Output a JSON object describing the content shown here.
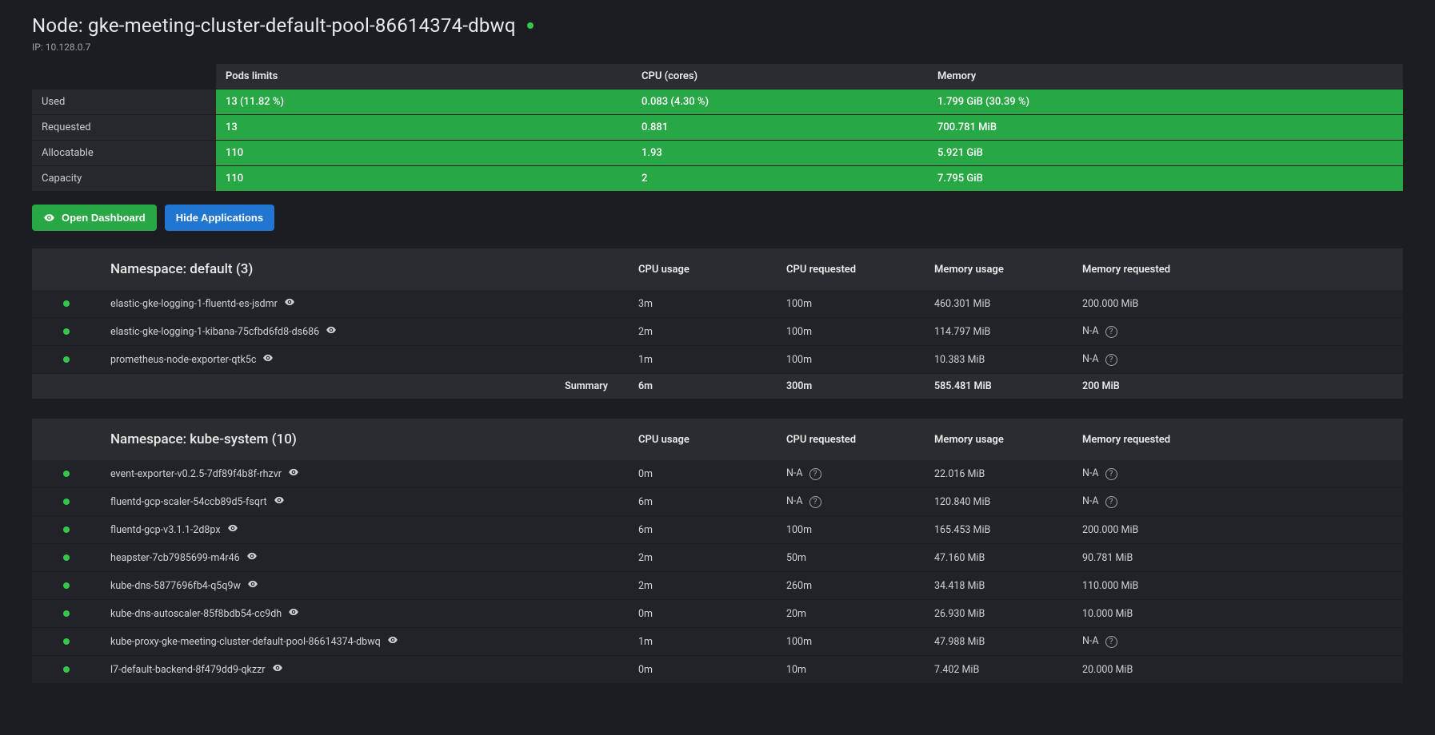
{
  "header": {
    "title": "Node: gke-meeting-cluster-default-pool-86614374-dbwq",
    "ip_label": "IP: 10.128.0.7"
  },
  "stats": {
    "cols": {
      "pods": "Pods limits",
      "cpu": "CPU (cores)",
      "mem": "Memory"
    },
    "rows": {
      "used": {
        "label": "Used",
        "pods": "13 (11.82 %)",
        "cpu": "0.083 (4.30 %)",
        "mem": "1.799 GiB (30.39 %)"
      },
      "requested": {
        "label": "Requested",
        "pods": "13",
        "cpu": "0.881",
        "mem": "700.781 MiB"
      },
      "alloc": {
        "label": "Allocatable",
        "pods": "110",
        "cpu": "1.93",
        "mem": "5.921 GiB"
      },
      "capacity": {
        "label": "Capacity",
        "pods": "110",
        "cpu": "2",
        "mem": "7.795 GiB"
      }
    }
  },
  "buttons": {
    "open_dashboard": "Open Dashboard",
    "hide_apps": "Hide Applications"
  },
  "ns_default": {
    "title": "Namespace: default (3)",
    "head": {
      "cpu_u": "CPU usage",
      "cpu_r": "CPU requested",
      "mem_u": "Memory usage",
      "mem_r": "Memory requested"
    },
    "rows": [
      {
        "name": "elastic-gke-logging-1-fluentd-es-jsdmr",
        "cpu_u": "3m",
        "cpu_r": "100m",
        "mem_u": "460.301 MiB",
        "mem_r": "200.000 MiB",
        "mem_r_na": false
      },
      {
        "name": "elastic-gke-logging-1-kibana-75cfbd6fd8-ds686",
        "cpu_u": "2m",
        "cpu_r": "100m",
        "mem_u": "114.797 MiB",
        "mem_r": "N-A",
        "mem_r_na": true
      },
      {
        "name": "prometheus-node-exporter-qtk5c",
        "cpu_u": "1m",
        "cpu_r": "100m",
        "mem_u": "10.383 MiB",
        "mem_r": "N-A",
        "mem_r_na": true
      }
    ],
    "summary": {
      "label": "Summary",
      "cpu_u": "6m",
      "cpu_r": "300m",
      "mem_u": "585.481 MiB",
      "mem_r": "200 MiB"
    }
  },
  "ns_kube": {
    "title": "Namespace: kube-system (10)",
    "head": {
      "cpu_u": "CPU usage",
      "cpu_r": "CPU requested",
      "mem_u": "Memory usage",
      "mem_r": "Memory requested"
    },
    "rows": [
      {
        "name": "event-exporter-v0.2.5-7df89f4b8f-rhzvr",
        "cpu_u": "0m",
        "cpu_r": "N-A",
        "cpu_r_na": true,
        "mem_u": "22.016 MiB",
        "mem_r": "N-A",
        "mem_r_na": true
      },
      {
        "name": "fluentd-gcp-scaler-54ccb89d5-fsqrt",
        "cpu_u": "6m",
        "cpu_r": "N-A",
        "cpu_r_na": true,
        "mem_u": "120.840 MiB",
        "mem_r": "N-A",
        "mem_r_na": true
      },
      {
        "name": "fluentd-gcp-v3.1.1-2d8px",
        "cpu_u": "6m",
        "cpu_r": "100m",
        "cpu_r_na": false,
        "mem_u": "165.453 MiB",
        "mem_r": "200.000 MiB",
        "mem_r_na": false
      },
      {
        "name": "heapster-7cb7985699-m4r46",
        "cpu_u": "2m",
        "cpu_r": "50m",
        "cpu_r_na": false,
        "mem_u": "47.160 MiB",
        "mem_r": "90.781 MiB",
        "mem_r_na": false
      },
      {
        "name": "kube-dns-5877696fb4-q5q9w",
        "cpu_u": "2m",
        "cpu_r": "260m",
        "cpu_r_na": false,
        "mem_u": "34.418 MiB",
        "mem_r": "110.000 MiB",
        "mem_r_na": false
      },
      {
        "name": "kube-dns-autoscaler-85f8bdb54-cc9dh",
        "cpu_u": "0m",
        "cpu_r": "20m",
        "cpu_r_na": false,
        "mem_u": "26.930 MiB",
        "mem_r": "10.000 MiB",
        "mem_r_na": false
      },
      {
        "name": "kube-proxy-gke-meeting-cluster-default-pool-86614374-dbwq",
        "cpu_u": "1m",
        "cpu_r": "100m",
        "cpu_r_na": false,
        "mem_u": "47.988 MiB",
        "mem_r": "N-A",
        "mem_r_na": true
      },
      {
        "name": "l7-default-backend-8f479dd9-qkzzr",
        "cpu_u": "0m",
        "cpu_r": "10m",
        "cpu_r_na": false,
        "mem_u": "7.402 MiB",
        "mem_r": "20.000 MiB",
        "mem_r_na": false
      }
    ]
  }
}
